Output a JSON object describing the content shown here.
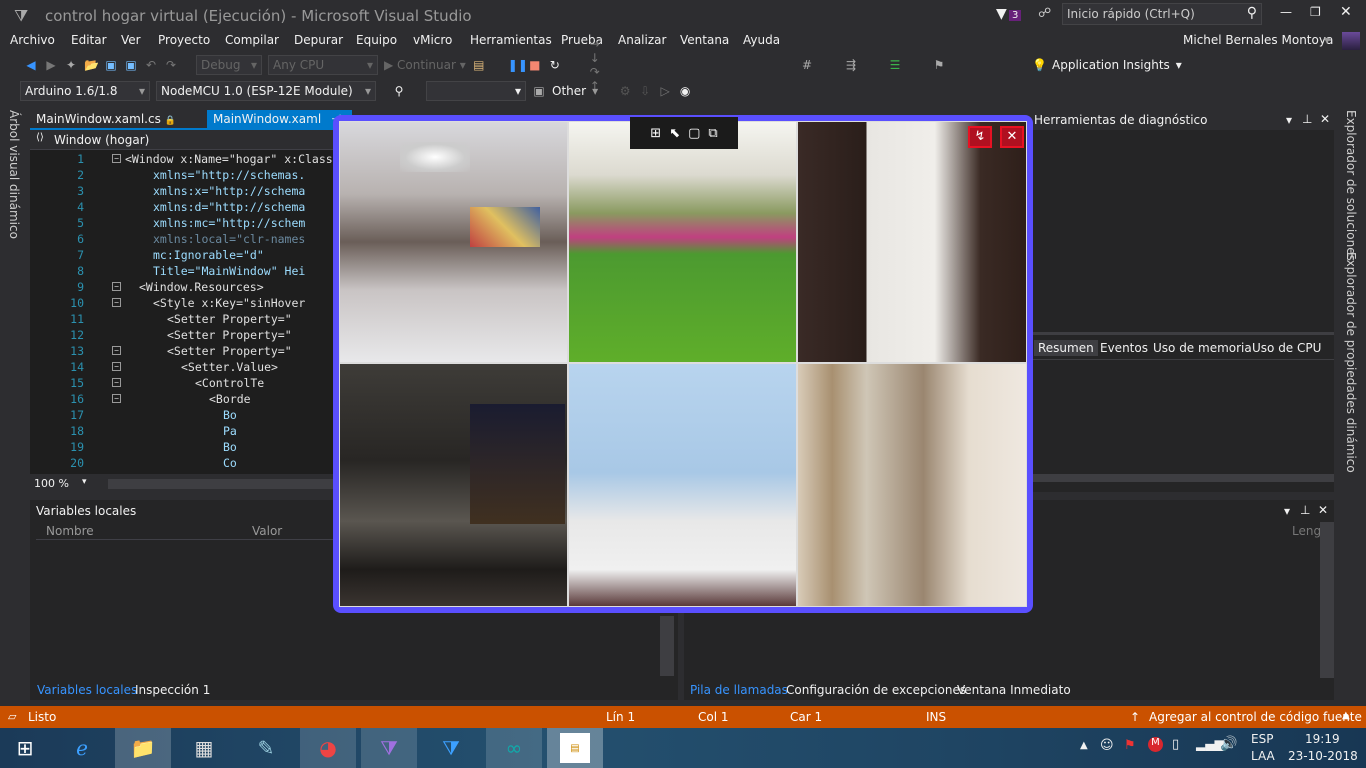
{
  "window": {
    "title": "control hogar virtual (Ejecución) - Microsoft Visual Studio",
    "notif_count": "3",
    "quick_launch_placeholder": "Inicio rápido (Ctrl+Q)"
  },
  "menu": [
    "Archivo",
    "Editar",
    "Ver",
    "Proyecto",
    "Compilar",
    "Depurar",
    "Equipo",
    "vMicro",
    "Herramientas",
    "Prueba",
    "Analizar",
    "Ventana",
    "Ayuda"
  ],
  "user": {
    "name": "Michel Bernales Montoya"
  },
  "toolbar": {
    "config": "Debug",
    "platform": "Any CPU",
    "continue": "Continuar",
    "app_insights": "Application Insights"
  },
  "toolbar2": {
    "ide_version": "Arduino 1.6/1.8",
    "board": "NodeMCU 1.0 (ESP-12E Module)",
    "other": "Other"
  },
  "left_strip": {
    "label": "Árbol visual dinámico"
  },
  "doc_tabs": [
    {
      "label": "MainWindow.xaml.cs",
      "active": false
    },
    {
      "label": "MainWindow.xaml",
      "active": true
    }
  ],
  "nav": {
    "scope": "Window (hogar)"
  },
  "editor": {
    "lines": [
      {
        "n": "1",
        "t": "<Window x:Name=\"hogar\" x:Class",
        "indent": 0,
        "fold": true
      },
      {
        "n": "2",
        "t": "xmlns=\"http://schemas.",
        "indent": 4
      },
      {
        "n": "3",
        "t": "xmlns:x=\"http://schema",
        "indent": 4
      },
      {
        "n": "4",
        "t": "xmlns:d=\"http://schema",
        "indent": 4
      },
      {
        "n": "5",
        "t": "xmlns:mc=\"http://schem",
        "indent": 4
      },
      {
        "n": "6",
        "t": "xmlns:local=\"clr-names",
        "indent": 4,
        "dim": true
      },
      {
        "n": "7",
        "t": "mc:Ignorable=\"d\"",
        "indent": 4
      },
      {
        "n": "8",
        "t": "Title=\"MainWindow\" Hei",
        "indent": 4
      },
      {
        "n": "9",
        "t": "<Window.Resources>",
        "indent": 2,
        "fold": true
      },
      {
        "n": "10",
        "t": "<Style x:Key=\"sinHover",
        "indent": 4,
        "fold": true
      },
      {
        "n": "11",
        "t": "<Setter Property=\"",
        "indent": 6
      },
      {
        "n": "12",
        "t": "<Setter Property=\"",
        "indent": 6
      },
      {
        "n": "13",
        "t": "<Setter Property=\"",
        "indent": 6,
        "fold": true
      },
      {
        "n": "14",
        "t": "<Setter.Value>",
        "indent": 8,
        "fold": true
      },
      {
        "n": "15",
        "t": "<ControlTe",
        "indent": 10,
        "fold": true
      },
      {
        "n": "16",
        "t": "<Borde",
        "indent": 12,
        "fold": true
      },
      {
        "n": "17",
        "t": "Bo",
        "indent": 14
      },
      {
        "n": "18",
        "t": "Pa",
        "indent": 14
      },
      {
        "n": "19",
        "t": "Bo",
        "indent": 14
      },
      {
        "n": "20",
        "t": "Co",
        "indent": 14
      }
    ],
    "zoom": "100 %"
  },
  "diagnostics": {
    "title": "Herramientas de diagnóstico",
    "tabs": [
      "Resumen",
      "Eventos",
      "Uso de memoria",
      "Uso de CPU"
    ]
  },
  "right_strip": [
    "Explorador de soluciones",
    "Explorador de propiedades dinámico"
  ],
  "locals": {
    "title": "Variables locales",
    "columns": [
      "Nombre",
      "Valor"
    ],
    "tabs": [
      "Variables locales",
      "Inspección 1"
    ]
  },
  "callstack": {
    "column": "Leng",
    "tabs": [
      "Pila de llamadas",
      "Configuración de excepciones",
      "Ventana Inmediato"
    ]
  },
  "status": {
    "ready": "Listo",
    "line": "Lín 1",
    "col": "Col 1",
    "char": "Car 1",
    "mode": "INS",
    "source_control": "Agregar al control de código fuente"
  },
  "taskbar": {
    "lang1": "ESP",
    "lang2": "LAA",
    "time": "19:19",
    "date": "23-10-2018",
    "apps": [
      "file-explorer",
      "calculator",
      "notepad",
      "chrome",
      "visual-studio",
      "vs-blue",
      "arduino",
      "running-app"
    ]
  },
  "colors": {
    "accent": "#007acc",
    "status": "#ca5100",
    "app_border": "#5a4fff"
  },
  "app": {
    "rooms": [
      "comedor",
      "jardin",
      "cocina",
      "dormitorio",
      "cuarto-infantil",
      "baño"
    ]
  }
}
